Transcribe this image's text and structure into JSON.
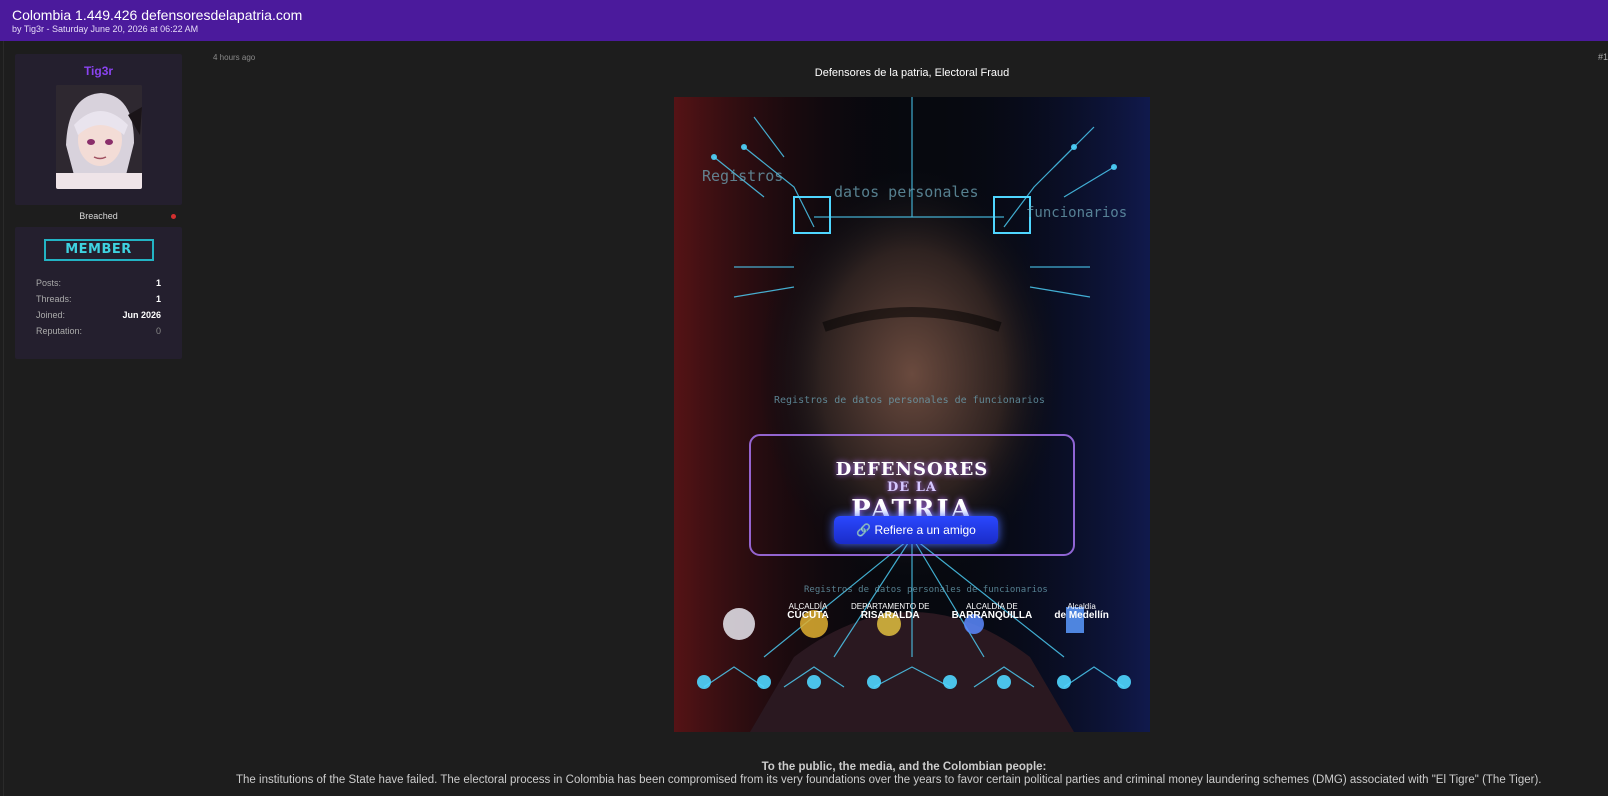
{
  "thread": {
    "title": "Colombia 1.449.426 defensoresdelapatria.com",
    "byline": "by Tig3r - Saturday June 20, 2026 at 06:22 AM"
  },
  "author": {
    "username": "Tig3r",
    "status": "Breached",
    "rank": "MEMBER",
    "stats": [
      {
        "label": "Posts:",
        "value": "1"
      },
      {
        "label": "Threads:",
        "value": "1"
      },
      {
        "label": "Joined:",
        "value": "Jun 2026"
      },
      {
        "label": "Reputation:",
        "value": "0"
      }
    ]
  },
  "post": {
    "time": "4 hours ago",
    "number": "#1",
    "heading": "Defensores de la patria, Electoral Fraud",
    "poster": {
      "overlay_left": "Registros",
      "overlay_center": "datos personales",
      "overlay_right": "funcionarios",
      "overlay_line": "Registros de datos personales de funcionarios",
      "overlay_line_bottom": "Registros de datos personales de funcionarios",
      "logo_line1": "DEFENSORES",
      "logo_line2": "DE LA",
      "logo_line3": "PATRIA",
      "cta": "Refiere a un amigo",
      "logos": [
        {
          "top": "ALCALDÍA",
          "main": "CÚCUTA"
        },
        {
          "top": "DEPARTAMENTO DE",
          "main": "RISARALDA"
        },
        {
          "top": "ALCALDÍA DE",
          "main": "BARRANQUILLA"
        },
        {
          "top": "Alcaldía",
          "main": "de Medellín"
        }
      ]
    },
    "lead": "To the public, the media, and the Colombian people:",
    "body": "The institutions of the State have failed. The electoral process in Colombia has been compromised from its very foundations over the years to favor certain political parties and criminal money laundering schemes (DMG) associated with \"El Tigre\" (The Tiger)."
  },
  "colors": {
    "header": "#4b1a9c",
    "username": "#8a43f0",
    "rank": "#23b3c4",
    "background": "#1d1d1d"
  }
}
